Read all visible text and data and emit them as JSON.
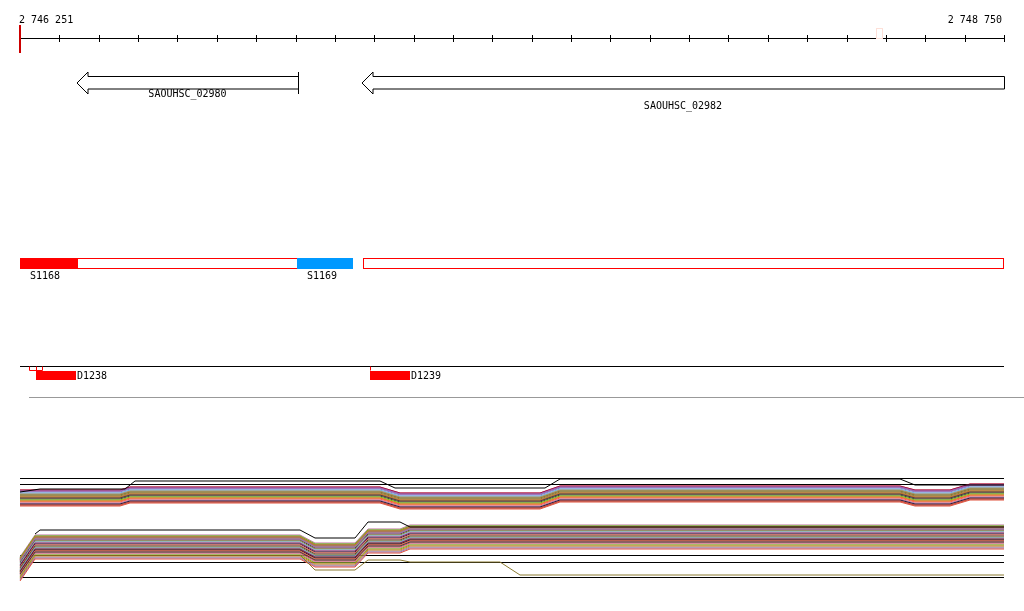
{
  "ruler": {
    "start_label": "2 746 251",
    "end_label": "2 748 750"
  },
  "genes": [
    {
      "label": "SAOUHSC_02980"
    },
    {
      "label": "SAOUHSC_02982"
    }
  ],
  "segments": [
    {
      "label": "S1168",
      "kind": "partial",
      "color": "#ff0000"
    },
    {
      "label": "S1169",
      "kind": "filled",
      "color": "#0099ff"
    },
    {
      "kind": "outline",
      "color": "#ff0000"
    }
  ],
  "features": [
    {
      "label": "D1238"
    },
    {
      "label": "D1239"
    }
  ]
}
